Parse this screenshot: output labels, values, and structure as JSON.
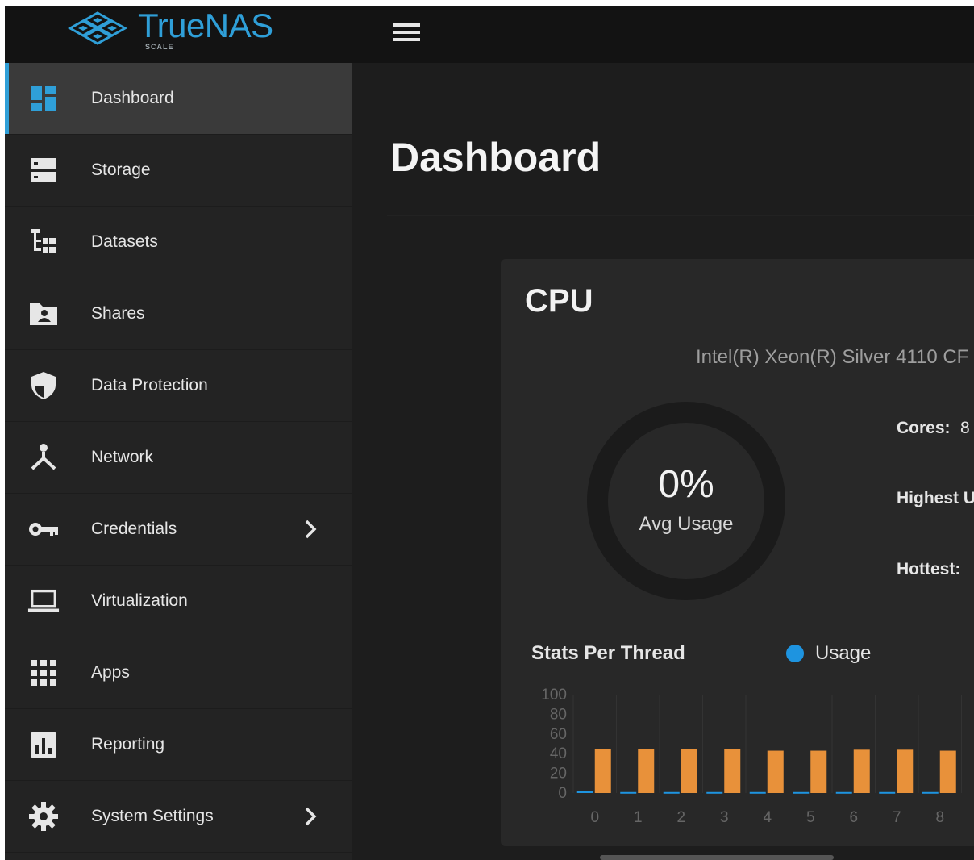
{
  "app": {
    "brand": "TrueNAS",
    "edition": "SCALE"
  },
  "sidebar": {
    "items": [
      {
        "label": "Dashboard",
        "icon": "dashboard-icon",
        "active": true,
        "chevron": false
      },
      {
        "label": "Storage",
        "icon": "storage-icon",
        "active": false,
        "chevron": false
      },
      {
        "label": "Datasets",
        "icon": "datasets-icon",
        "active": false,
        "chevron": false
      },
      {
        "label": "Shares",
        "icon": "shares-icon",
        "active": false,
        "chevron": false
      },
      {
        "label": "Data Protection",
        "icon": "shield-icon",
        "active": false,
        "chevron": false
      },
      {
        "label": "Network",
        "icon": "network-icon",
        "active": false,
        "chevron": false
      },
      {
        "label": "Credentials",
        "icon": "key-icon",
        "active": false,
        "chevron": true
      },
      {
        "label": "Virtualization",
        "icon": "laptop-icon",
        "active": false,
        "chevron": false
      },
      {
        "label": "Apps",
        "icon": "apps-grid-icon",
        "active": false,
        "chevron": false
      },
      {
        "label": "Reporting",
        "icon": "reporting-icon",
        "active": false,
        "chevron": false
      },
      {
        "label": "System Settings",
        "icon": "gear-icon",
        "active": false,
        "chevron": true
      }
    ]
  },
  "main": {
    "title": "Dashboard"
  },
  "cpu": {
    "title": "CPU",
    "model": "Intel(R) Xeon(R) Silver 4110 CF",
    "avg_usage_value": "0%",
    "avg_usage_fraction": 0,
    "avg_usage_label": "Avg Usage",
    "cores_label": "Cores:",
    "cores_value": "8",
    "highest_label": "Highest U",
    "hottest_label": "Hottest:",
    "stats_title": "Stats Per Thread",
    "legend_label": "Usage"
  },
  "colors": {
    "accent": "#2f9fd8",
    "usage": "#1e94e0",
    "temperature": "#e8913a"
  },
  "chart_data": {
    "type": "bar",
    "categories": [
      "0",
      "1",
      "2",
      "3",
      "4",
      "5",
      "6",
      "7",
      "8"
    ],
    "series": [
      {
        "name": "Usage",
        "values": [
          2,
          1,
          1,
          1,
          1,
          1,
          1,
          1,
          1
        ]
      },
      {
        "values": [
          45,
          45,
          45,
          45,
          43,
          43,
          44,
          44,
          43
        ]
      }
    ],
    "yticks": [
      0,
      20,
      40,
      60,
      80,
      100
    ],
    "ylim": [
      0,
      100
    ],
    "grid": true,
    "legend": "top"
  }
}
